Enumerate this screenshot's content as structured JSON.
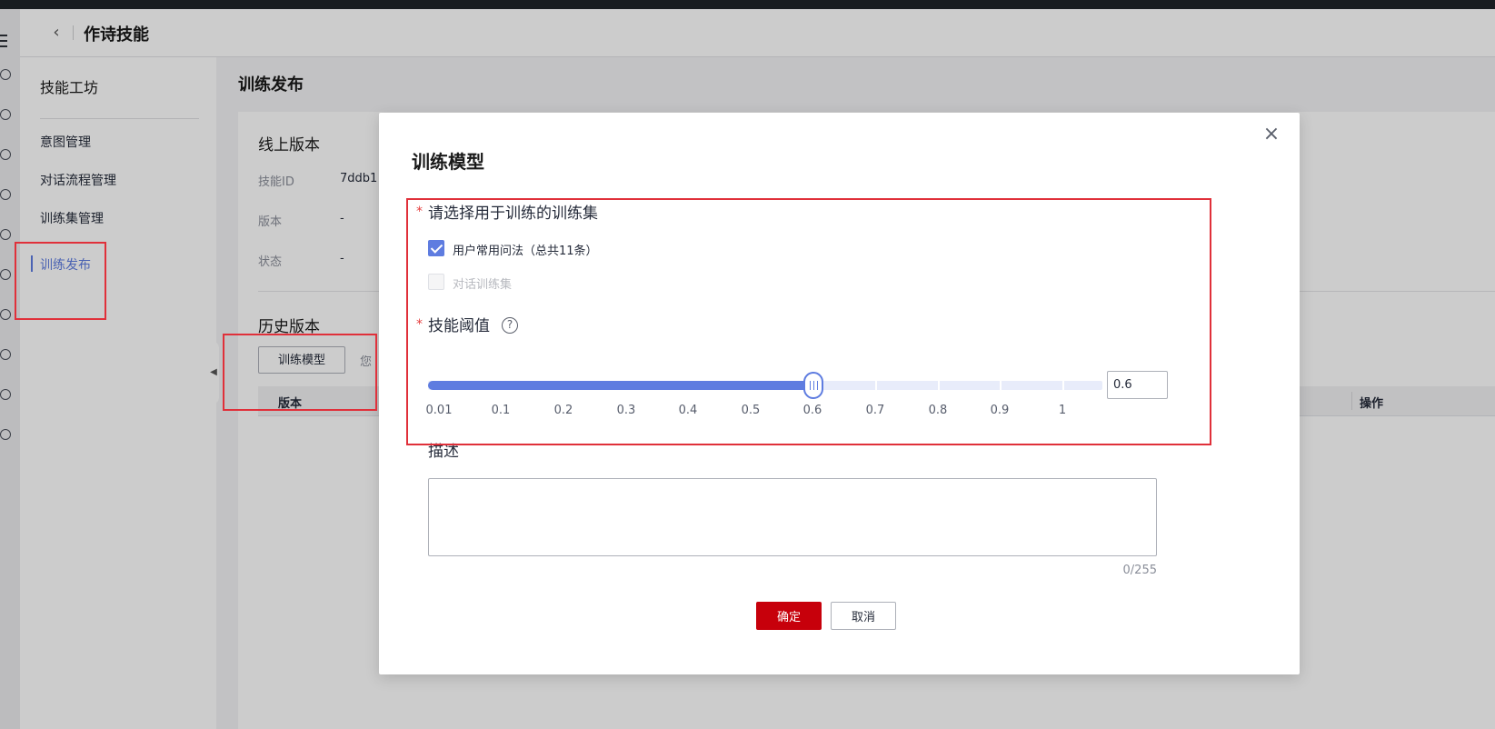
{
  "header": {
    "back_icon": "chevron-left-icon",
    "title": "作诗技能"
  },
  "sidenav": {
    "title": "技能工坊",
    "items": [
      {
        "label": "意图管理",
        "active": false
      },
      {
        "label": "对话流程管理",
        "active": false
      },
      {
        "label": "训练集管理",
        "active": false
      },
      {
        "label": "训练发布",
        "active": true
      }
    ]
  },
  "page": {
    "title": "训练发布",
    "online_version": {
      "title": "线上版本",
      "fields": [
        {
          "label": "技能ID",
          "value": "7ddb1"
        },
        {
          "label": "版本",
          "value": "-"
        },
        {
          "label": "状态",
          "value": "-"
        }
      ]
    },
    "history": {
      "title": "历史版本",
      "train_button": "训练模型",
      "hint": "您",
      "columns": [
        "版本",
        "操作"
      ]
    }
  },
  "modal": {
    "title": "训练模型",
    "close_icon": "close-icon",
    "trainset": {
      "label": "请选择用于训练的训练集",
      "options": [
        {
          "label": "用户常用问法（总共11条）",
          "checked": true,
          "disabled": false
        },
        {
          "label": "对话训练集",
          "checked": false,
          "disabled": true
        }
      ]
    },
    "threshold": {
      "label": "技能阈值",
      "help_icon": "help-circle-icon",
      "value": 0.6,
      "input_value": "0.6",
      "ticks": [
        "0.01",
        "0.1",
        "0.2",
        "0.3",
        "0.4",
        "0.5",
        "0.6",
        "0.7",
        "0.8",
        "0.9",
        "1"
      ]
    },
    "description": {
      "label": "描述",
      "value": "",
      "counter": "0/255"
    },
    "buttons": {
      "confirm": "确定",
      "cancel": "取消"
    }
  },
  "colors": {
    "accent": "#5e7ce0",
    "primary_button": "#c7000b",
    "required": "#e53e3e",
    "annotation_box": "#e0303a"
  }
}
